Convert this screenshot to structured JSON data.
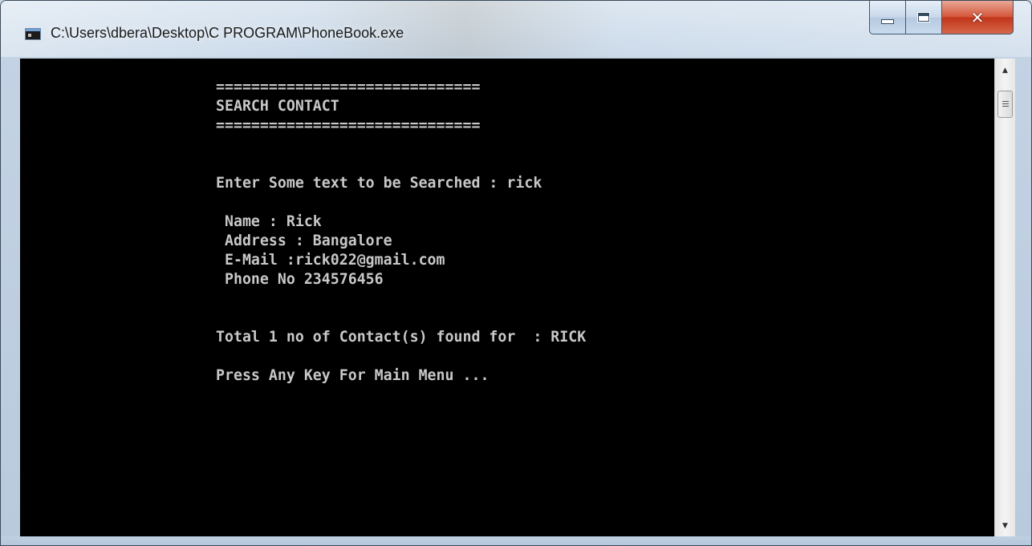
{
  "window": {
    "title": "C:\\Users\\dbera\\Desktop\\C PROGRAM\\PhoneBook.exe",
    "app_icon": "console-icon",
    "buttons": {
      "minimize_icon": "minimize-icon",
      "maximize_icon": "maximize-icon",
      "close_icon": "close-icon"
    }
  },
  "console": {
    "lines": [
      "==============================",
      "SEARCH CONTACT",
      "==============================",
      "Enter Some text to be Searched : rick",
      " Name : Rick",
      " Address : Bangalore",
      " E-Mail :rick022@gmail.com",
      " Phone No 234576456",
      "Total 1 no of Contact(s) found for  : RICK",
      "Press Any Key For Main Menu ..."
    ]
  },
  "scrollbar": {
    "up_icon": "scroll-up-arrow-icon",
    "down_icon": "scroll-down-arrow-icon"
  },
  "colors": {
    "console_background": "#000000",
    "console_text": "#c8c8c8",
    "close_button": "#c8452a"
  }
}
